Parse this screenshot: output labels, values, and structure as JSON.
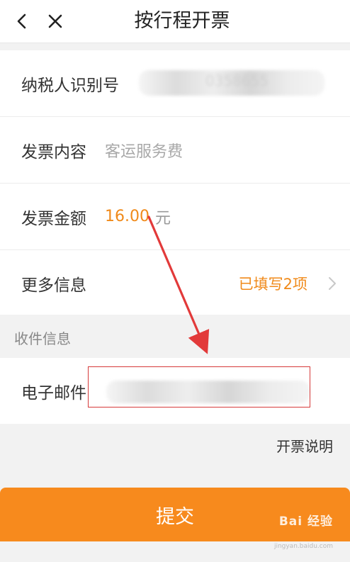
{
  "header": {
    "title": "按行程开票"
  },
  "form": {
    "taxpayer_id": {
      "label": "纳税人识别号",
      "value_partial": "0358655"
    },
    "invoice_content": {
      "label": "发票内容",
      "value": "客运服务费"
    },
    "invoice_amount": {
      "label": "发票金额",
      "amount": "16.00",
      "unit": "元"
    },
    "more_info": {
      "label": "更多信息",
      "status": "已填写2项"
    }
  },
  "recipient_section": {
    "title": "收件信息"
  },
  "email": {
    "label": "电子邮件"
  },
  "help_link": "开票说明",
  "submit_button": "提交",
  "watermark": {
    "brand": "Bai 经验",
    "url": "jingyan.baidu.com"
  },
  "icons": {
    "back": "back-chevron-icon",
    "close": "close-icon",
    "more": "chevron-right-icon"
  },
  "colors": {
    "accent": "#f78a1d",
    "amount": "#f08a1a",
    "annotation": "#d63a3a"
  }
}
